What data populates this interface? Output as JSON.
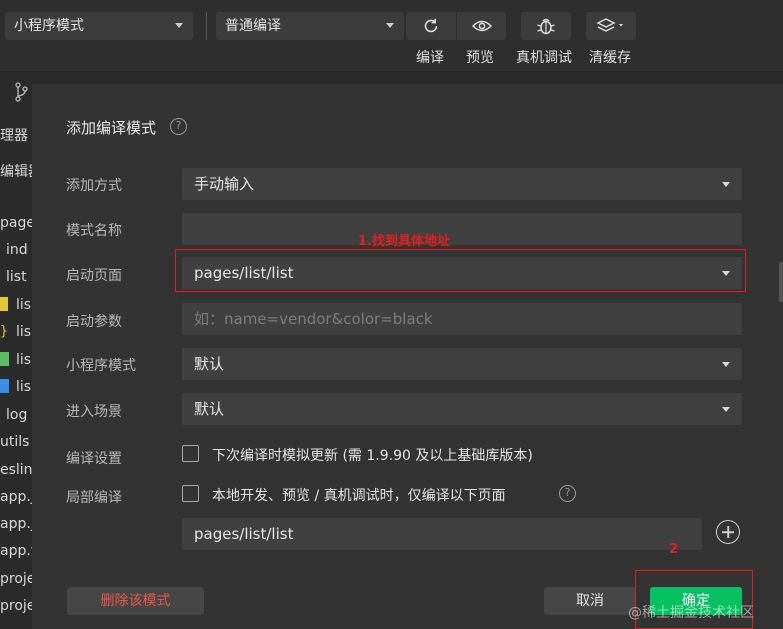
{
  "toolbar": {
    "mode_select": "小程序模式",
    "compile_select": "普通编译",
    "buttons": [
      {
        "label": "编译",
        "icon": "refresh-icon"
      },
      {
        "label": "预览",
        "icon": "eye-icon"
      },
      {
        "label": "真机调试",
        "icon": "bug-icon"
      },
      {
        "label": "清缓存",
        "icon": "layers-icon"
      }
    ]
  },
  "sidebar": {
    "items": [
      "理器",
      "编辑器",
      "page",
      "ind",
      "list",
      "lis",
      "lis",
      "lis",
      "lis",
      "log",
      "utils",
      "eslin",
      "app.j",
      "app.j",
      "app.w",
      "proje",
      "proje"
    ]
  },
  "dialog": {
    "title": "添加编译模式",
    "fields": {
      "add_method_label": "添加方式",
      "add_method_value": "手动输入",
      "mode_name_label": "模式名称",
      "mode_name_value": "",
      "start_page_label": "启动页面",
      "start_page_value": "pages/list/list",
      "start_params_label": "启动参数",
      "start_params_placeholder": "如：name=vendor&color=black",
      "mini_mode_label": "小程序模式",
      "mini_mode_value": "默认",
      "scene_label": "进入场景",
      "scene_value": "默认",
      "compile_settings_label": "编译设置",
      "compile_settings_option": "下次编译时模拟更新 (需 1.9.90 及以上基础库版本)",
      "partial_compile_label": "局部编译",
      "partial_compile_option": "本地开发、预览 / 真机调试时，仅编译以下页面",
      "partial_page_value": "pages/list/list"
    },
    "buttons": {
      "delete": "删除该模式",
      "cancel": "取消",
      "confirm": "确定"
    }
  },
  "annotations": {
    "step1": "1.找到具体地址",
    "step2": "2"
  },
  "watermark": "@稀土掘金技术社区",
  "colors": {
    "accent_green": "#07c160",
    "annotation_red": "#e02020",
    "delete_red": "#e8584e"
  }
}
